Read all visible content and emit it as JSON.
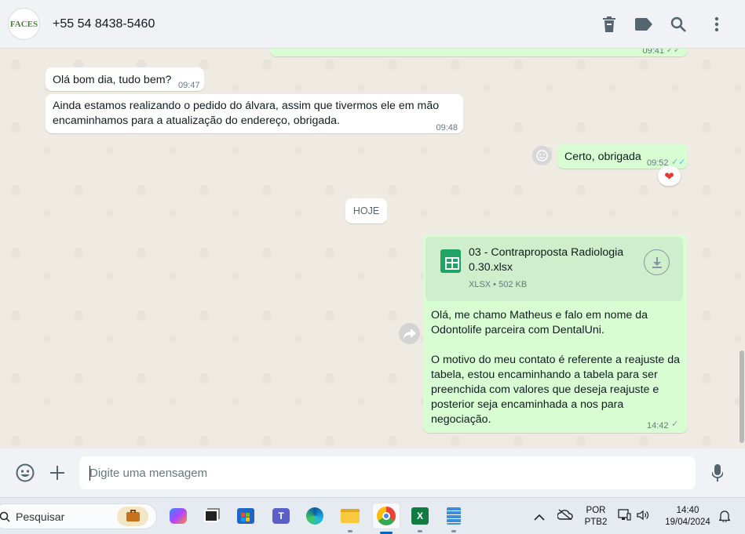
{
  "header": {
    "avatar_text": "FACES",
    "contact_name": "+55 54 8438-5460",
    "icons": [
      "delete-icon",
      "label-icon",
      "search-icon",
      "menu-dots-icon"
    ]
  },
  "messages": [
    {
      "direction": "out",
      "text": "",
      "time": "09:41",
      "partial": true
    },
    {
      "direction": "in",
      "text": "Olá bom dia, tudo bem?",
      "time": "09:47"
    },
    {
      "direction": "in",
      "text": "Ainda estamos realizando o pedido do álvara, assim que tivermos ele em mão encaminhamos para a atualização do endereço, obrigada.",
      "time": "09:48"
    },
    {
      "direction": "out",
      "text": "Certo, obrigada",
      "time": "09:52",
      "reaction": "heart"
    },
    {
      "direction": "out",
      "type": "document",
      "file_name": "03 - Contraproposta Radiologia 0.30.xlsx",
      "file_meta": "XLSX • 502 KB",
      "text_p1": "Olá, me chamo Matheus e falo em nome da Odontolife parceira com DentalUni.",
      "text_p2": "O motivo do meu contato é referente a reajuste da tabela, estou encaminhando a tabela para ser preenchida com valores que deseja reajuste e posterior seja encaminhada a nos para negociação.",
      "time": "14:42"
    }
  ],
  "day_separator": "HOJE",
  "composer": {
    "placeholder": "Digite uma mensagem"
  },
  "taskbar": {
    "search_label": "Pesquisar",
    "language_top": "POR",
    "language_bottom": "PTB2",
    "clock_time": "14:40",
    "clock_date": "19/04/2024"
  },
  "colors": {
    "incoming_bubble": "#ffffff",
    "outgoing_bubble": "#d9fdd3",
    "chat_background": "#efeae2",
    "header_background": "#f0f2f5"
  }
}
